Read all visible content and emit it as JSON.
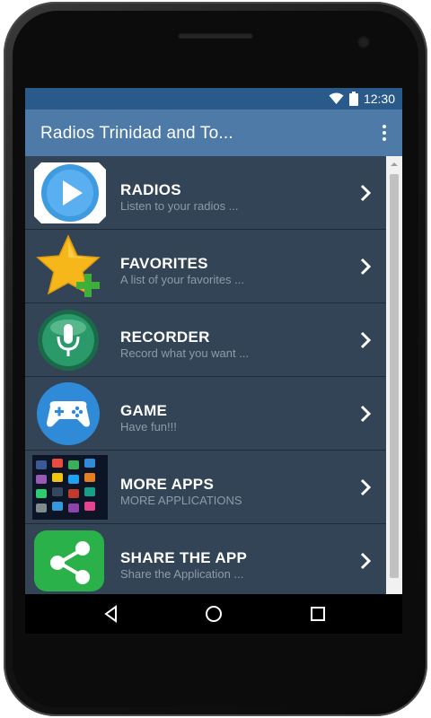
{
  "status_bar": {
    "time": "12:30",
    "icons": [
      "wifi-icon",
      "battery-icon"
    ]
  },
  "app_bar": {
    "title": "Radios Trinidad and To...",
    "overflow_icon": "more-vert-icon"
  },
  "menu": [
    {
      "title": "RADIOS",
      "subtitle": "Listen to your radios ...",
      "icon": "play-icon"
    },
    {
      "title": "FAVORITES",
      "subtitle": "A list of your favorites ...",
      "icon": "star-add-icon"
    },
    {
      "title": "RECORDER",
      "subtitle": "Record what you want ...",
      "icon": "microphone-icon"
    },
    {
      "title": "GAME",
      "subtitle": "Have fun!!!",
      "icon": "gamepad-icon"
    },
    {
      "title": "MORE APPS",
      "subtitle": "MORE APPLICATIONS",
      "icon": "app-grid-icon"
    },
    {
      "title": "SHARE THE APP",
      "subtitle": "Share the Application ...",
      "icon": "share-icon"
    }
  ],
  "nav_bar": {
    "buttons": [
      "back-icon",
      "home-icon",
      "recents-icon"
    ]
  },
  "colors": {
    "status_bar": "#2a5a8a",
    "app_bar": "#4d7aa6",
    "list_background": "#324456",
    "subtitle_text": "#8f9ba8"
  }
}
